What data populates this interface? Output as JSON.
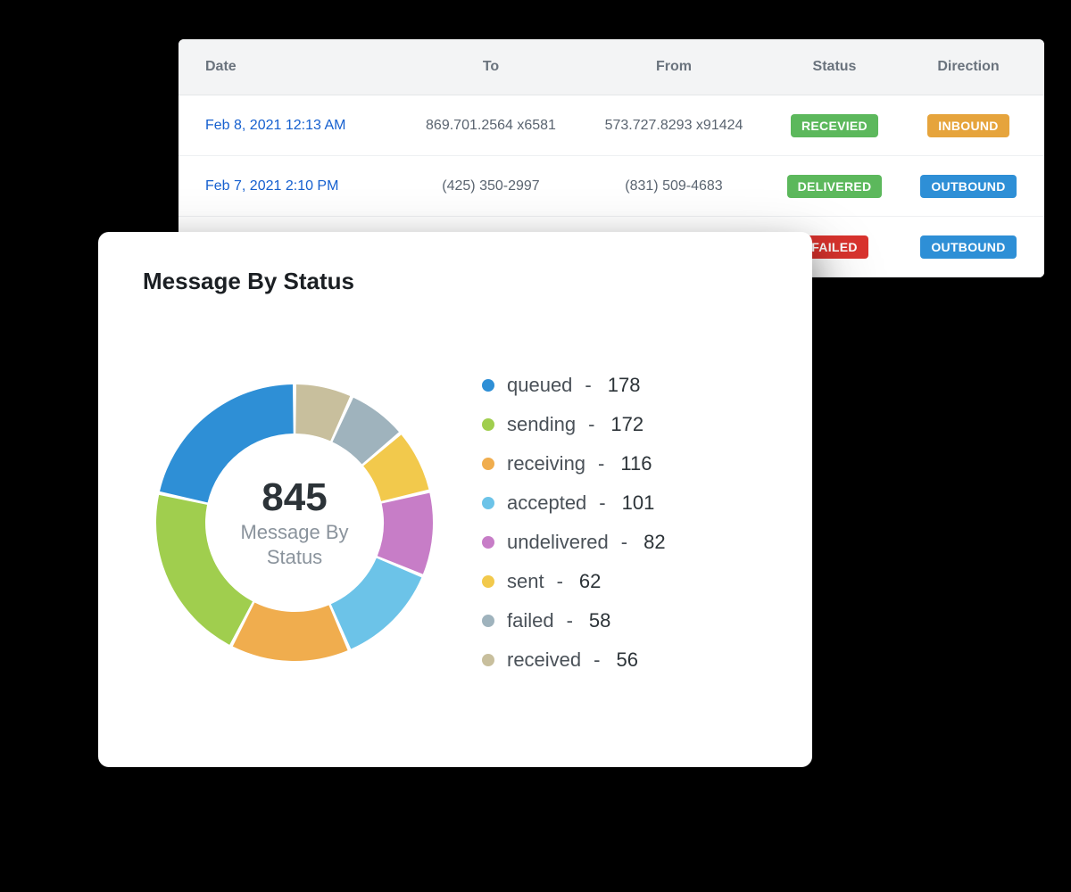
{
  "table": {
    "headers": {
      "date": "Date",
      "to": "To",
      "from": "From",
      "status": "Status",
      "direction": "Direction"
    },
    "rows": [
      {
        "date": "Feb 8, 2021 12:13 AM",
        "to": "869.701.2564 x6581",
        "from": "573.727.8293 x91424",
        "status": "RECEVIED",
        "status_color": "#5cb85c",
        "direction": "INBOUND",
        "direction_color": "#e6a43c"
      },
      {
        "date": "Feb 7, 2021 2:10 PM",
        "to": "(425) 350-2997",
        "from": "(831) 509-4683",
        "status": "DELIVERED",
        "status_color": "#5cb85c",
        "direction": "OUTBOUND",
        "direction_color": "#2e8fd6"
      },
      {
        "date": "",
        "to": "",
        "from": "",
        "status": "FAILED",
        "status_color": "#d9332e",
        "direction": "OUTBOUND",
        "direction_color": "#2e8fd6"
      }
    ]
  },
  "card": {
    "title": "Message By Status",
    "center_total": "845",
    "center_label": "Message By Status"
  },
  "chart_data": {
    "type": "pie",
    "title": "Message By Status",
    "total": 845,
    "series": [
      {
        "name": "queued",
        "value": 178,
        "color": "#2e8fd6"
      },
      {
        "name": "sending",
        "value": 172,
        "color": "#a0ce4e"
      },
      {
        "name": "receiving",
        "value": 116,
        "color": "#f0ad4e"
      },
      {
        "name": "accepted",
        "value": 101,
        "color": "#6cc3e8"
      },
      {
        "name": "undelivered",
        "value": 82,
        "color": "#c77dc7"
      },
      {
        "name": "sent",
        "value": 62,
        "color": "#f2c94c"
      },
      {
        "name": "failed",
        "value": 58,
        "color": "#9fb3bd"
      },
      {
        "name": "received",
        "value": 56,
        "color": "#c8bf9d"
      }
    ]
  }
}
